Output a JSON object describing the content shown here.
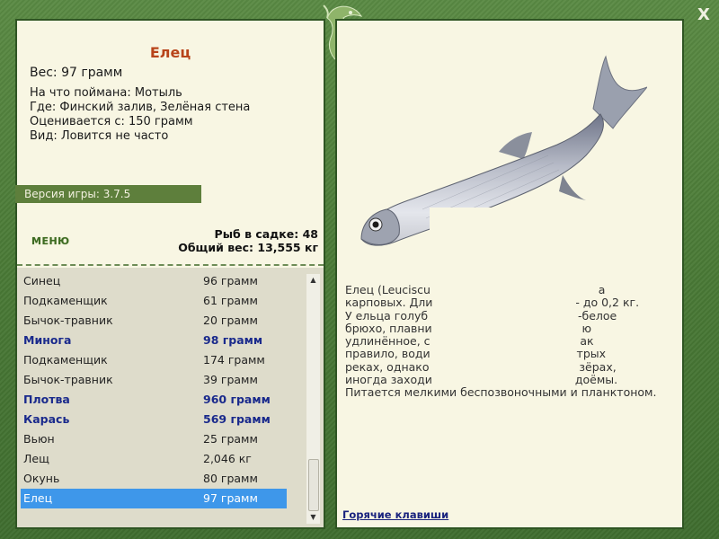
{
  "window": {
    "close_label": "X"
  },
  "fish_card": {
    "title": "Елец",
    "weight": "Вес: 97 грамм",
    "bait": "На что поймана: Мотыль",
    "location": "Где: Финский залив, Зелёная стена",
    "valued_from": "Оценивается с: 150 грамм",
    "species_note": "Вид: Ловится не часто"
  },
  "version": {
    "label": "Версия игры: 3.7.5"
  },
  "menu": {
    "label": "МЕНЮ"
  },
  "stats": {
    "fish_in_keepnet": "Рыб в садке: 48",
    "total_weight": "Общий вес: 13,555 кг"
  },
  "catch_list": {
    "items": [
      {
        "name": "Синец",
        "weight": "96 грамм",
        "bold": false,
        "selected": false
      },
      {
        "name": "Подкаменщик",
        "weight": "61 грамм",
        "bold": false,
        "selected": false
      },
      {
        "name": "Бычок-травник",
        "weight": "20 грамм",
        "bold": false,
        "selected": false
      },
      {
        "name": "Минога",
        "weight": "98 грамм",
        "bold": true,
        "selected": false
      },
      {
        "name": "Подкаменщик",
        "weight": "174 грамм",
        "bold": false,
        "selected": false
      },
      {
        "name": "Бычок-травник",
        "weight": "39 грамм",
        "bold": false,
        "selected": false
      },
      {
        "name": "Плотва",
        "weight": "960 грамм",
        "bold": true,
        "selected": false
      },
      {
        "name": "Карась",
        "weight": "569 грамм",
        "bold": true,
        "selected": false
      },
      {
        "name": "Вьюн",
        "weight": "25 грамм",
        "bold": false,
        "selected": false
      },
      {
        "name": "Лещ",
        "weight": "2,046 кг",
        "bold": false,
        "selected": false
      },
      {
        "name": "Окунь",
        "weight": "80 грамм",
        "bold": false,
        "selected": false
      },
      {
        "name": "Елец",
        "weight": "97 грамм",
        "bold": false,
        "selected": true
      }
    ]
  },
  "scroll": {
    "up_icon": "▲",
    "down_icon": "▼"
  },
  "description": {
    "lines": [
      "Елец (Leuciscu                                               а",
      "карповых. Дли                                        - до 0,2 кг.",
      "У ельца голуб                                          -белое",
      "брюхо, плавни                                          ю",
      "удлинённое, с                                          ак",
      "правило, води                                         трых",
      "реках, однако                                          зёрах,",
      "иногда заходи                                        доёмы.",
      "Питается мелкими беспозвоночными и планктоном."
    ]
  },
  "hotkeys": {
    "label": "Горячие клавиши"
  },
  "colors": {
    "frame_green": "#4d7a3a",
    "panel_bg": "#f8f6e3",
    "title_orange": "#b8441a",
    "selected_blue": "#3e97ea",
    "bold_item_blue": "#1a2a8c"
  }
}
